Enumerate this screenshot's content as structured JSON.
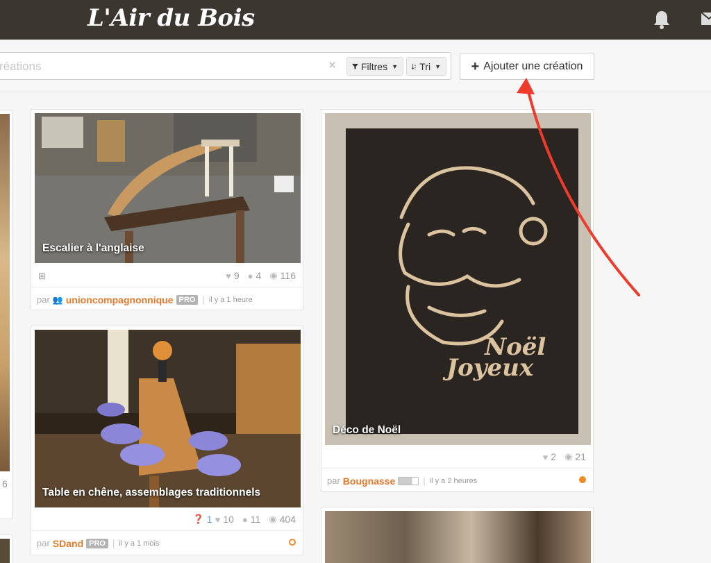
{
  "header": {
    "logo": "L'Air du Bois"
  },
  "toolbar": {
    "search_placeholder": "réations",
    "clear_icon": "×",
    "filter_label": "Filtres",
    "sort_label": "Tri",
    "add_label": "Ajouter une création"
  },
  "cards": {
    "left_partial": {
      "stat": "6"
    },
    "escalier": {
      "title": "Escalier à l'anglaise",
      "likes": "9",
      "comments": "4",
      "views": "116",
      "by": "par",
      "author": "unioncompagnonnique",
      "badge": "PRO",
      "time": "il y a 1 heure"
    },
    "noel": {
      "title": "Déco de Noël",
      "likes": "2",
      "views": "21",
      "by": "par",
      "author": "Bougnasse",
      "time": "il y a 2 heures",
      "status_color": "#f08a24"
    },
    "table": {
      "title": "Table en chêne, assemblages traditionnels",
      "questions": "1",
      "likes": "10",
      "comments": "11",
      "views": "404",
      "by": "par",
      "author": "SDand",
      "badge": "PRO",
      "time": "il y a 1 mois",
      "status_color": "#f08a24"
    }
  },
  "colors": {
    "accent": "#e8782b",
    "topbar": "#3b3630",
    "arrow": "#ef3b2c"
  }
}
